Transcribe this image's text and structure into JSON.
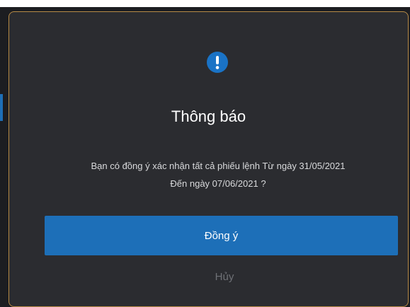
{
  "dialog": {
    "icon": "exclamation-circle-icon",
    "title": "Thông báo",
    "message_line1": "Bạn có đồng ý xác nhận tất cả phiếu lệnh Từ ngày 31/05/2021",
    "message_line2": "Đến ngày 07/06/2021 ?",
    "confirm_label": "Đồng ý",
    "cancel_label": "Hủy"
  },
  "colors": {
    "modal_background": "#2b2c30",
    "modal_border": "#b68a45",
    "accent": "#1d6fb8",
    "muted_text": "#6f7176"
  }
}
